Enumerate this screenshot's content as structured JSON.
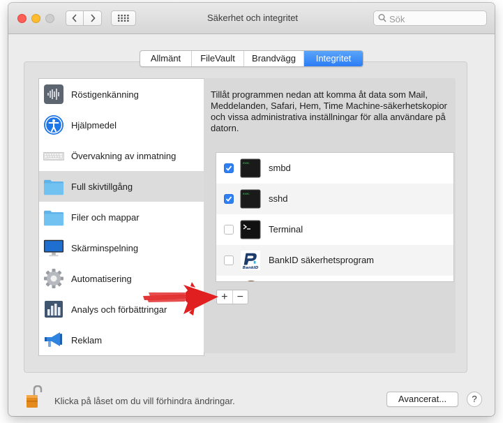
{
  "window": {
    "title": "Säkerhet och integritet"
  },
  "search": {
    "placeholder": "Sök"
  },
  "tabs": [
    {
      "label": "Allmänt",
      "active": false
    },
    {
      "label": "FileVault",
      "active": false
    },
    {
      "label": "Brandvägg",
      "active": false
    },
    {
      "label": "Integritet",
      "active": true
    }
  ],
  "sidebar": {
    "items": [
      {
        "label": "Röstigenkänning",
        "icon": "voice-waveform-icon",
        "selected": false
      },
      {
        "label": "Hjälpmedel",
        "icon": "accessibility-icon",
        "selected": false
      },
      {
        "label": "Övervakning av inmatning",
        "icon": "keyboard-icon",
        "selected": false
      },
      {
        "label": "Full skivtillgång",
        "icon": "folder-icon",
        "selected": true
      },
      {
        "label": "Filer och mappar",
        "icon": "folder-icon",
        "selected": false
      },
      {
        "label": "Skärminspelning",
        "icon": "display-icon",
        "selected": false
      },
      {
        "label": "Automatisering",
        "icon": "gear-icon",
        "selected": false
      },
      {
        "label": "Analys och förbättringar",
        "icon": "analytics-icon",
        "selected": false
      },
      {
        "label": "Reklam",
        "icon": "megaphone-icon",
        "selected": false
      }
    ]
  },
  "main": {
    "description": "Tillåt programmen nedan att komma åt data som Mail, Meddelanden, Safari, Hem, Time Machine-säkerhetskopior och vissa administrativa inställningar för alla användare på datorn.",
    "apps": [
      {
        "label": "smbd",
        "checked": true,
        "icon": "exec-icon"
      },
      {
        "label": "sshd",
        "checked": true,
        "icon": "exec-icon"
      },
      {
        "label": "Terminal",
        "checked": false,
        "icon": "terminal-icon"
      },
      {
        "label": "BankID säkerhetsprogram",
        "checked": false,
        "icon": "bankid-icon"
      }
    ],
    "add_label": "+",
    "remove_label": "−"
  },
  "footer": {
    "lock_text": "Klicka på låset om du vill förhindra ändringar.",
    "advanced_label": "Avancerat...",
    "help_label": "?"
  },
  "colors": {
    "accent": "#2c7df5",
    "selection": "#dcdcdc",
    "arrow": "#e02020"
  }
}
